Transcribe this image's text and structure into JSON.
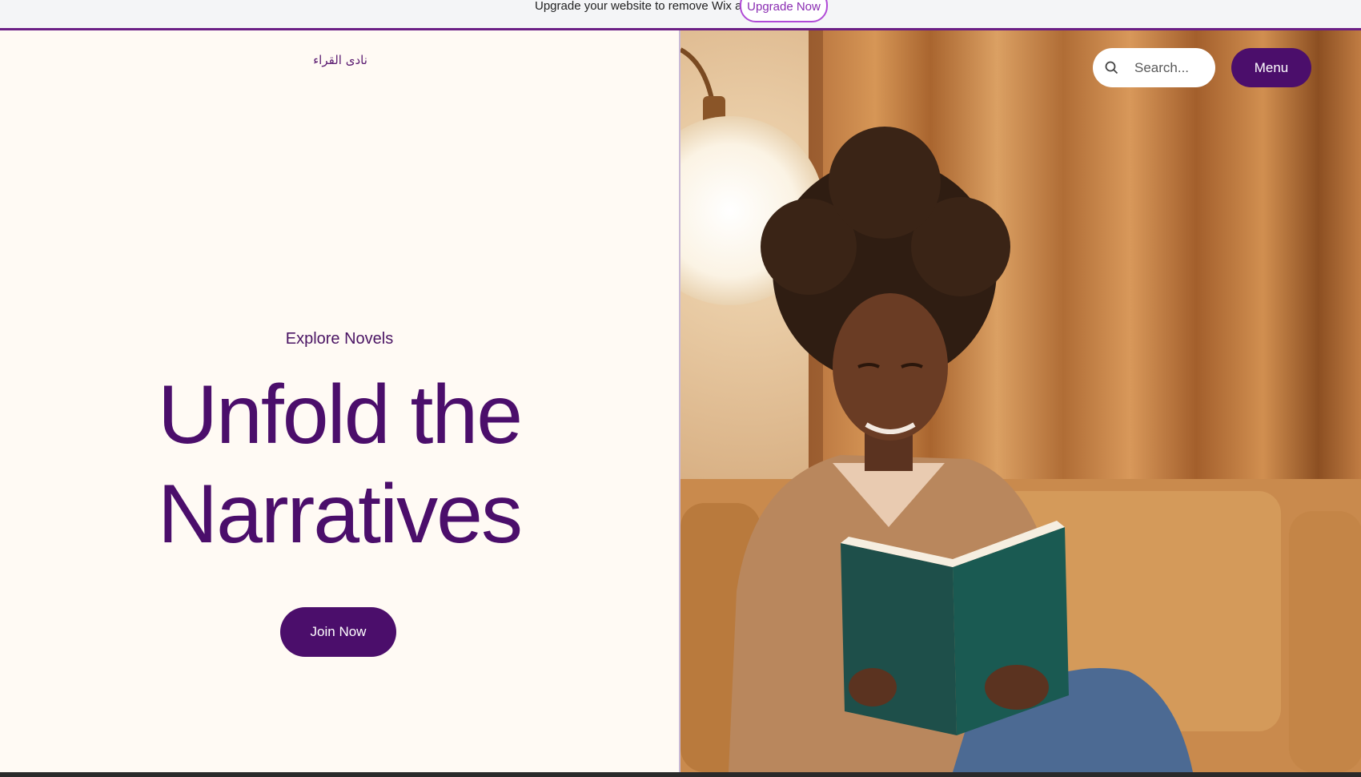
{
  "wix_banner": {
    "text": "Upgrade your website to remove Wix ads",
    "button_label": "Upgrade Now"
  },
  "site": {
    "logo_text": "نادى القراء"
  },
  "hero": {
    "eyebrow": "Explore Novels",
    "title_line1": "Unfold the",
    "title_line2": "Narratives",
    "cta_label": "Join Now"
  },
  "header": {
    "search_placeholder": "Search...",
    "menu_label": "Menu"
  },
  "colors": {
    "brand_purple": "#4b0e6b",
    "background_cream": "#fffaf4",
    "banner_border": "#6b1f86"
  }
}
